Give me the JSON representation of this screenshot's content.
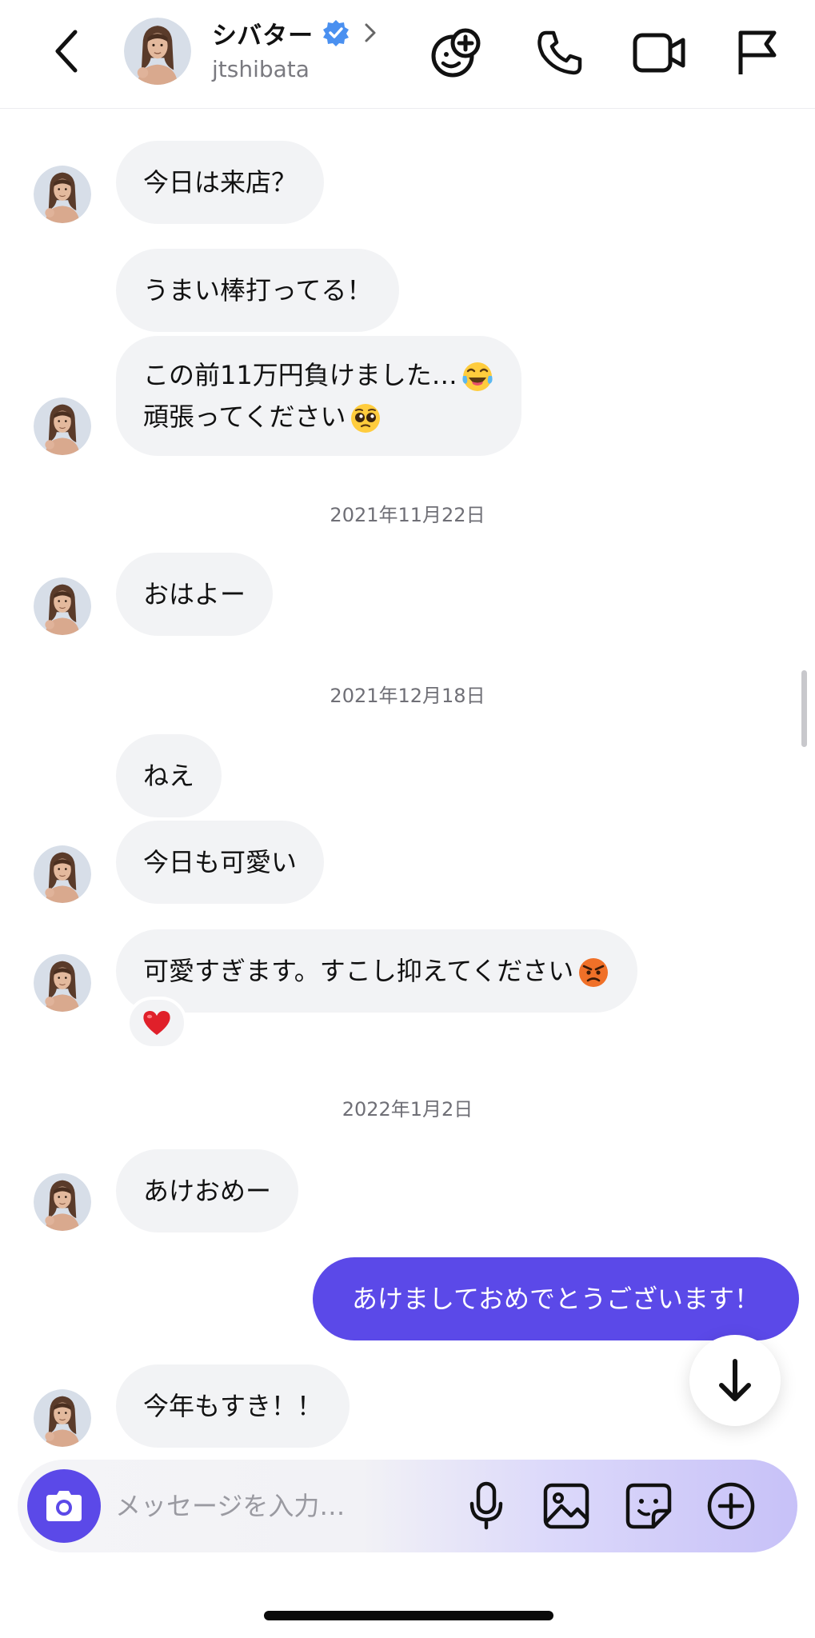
{
  "header": {
    "name": "シバター",
    "username": "jtshibata"
  },
  "messages": [
    {
      "text": "今日は来店？",
      "direction": "incoming"
    },
    {
      "text": "うまい棒打ってる！",
      "direction": "incoming"
    },
    {
      "line1": "この前11万円負けました…",
      "line1_emoji": "face-with-tears-of-joy",
      "line2": "頑張ってください",
      "line2_emoji": "pleading-face",
      "direction": "incoming"
    },
    {
      "text": "おはよー",
      "direction": "incoming"
    },
    {
      "text": "ねえ",
      "direction": "incoming"
    },
    {
      "text": "今日も可愛い",
      "direction": "incoming"
    },
    {
      "text": "可愛すぎます。すこし抑えてください",
      "emoji": "angry-face",
      "reaction": "red-heart",
      "direction": "incoming"
    },
    {
      "text": "あけおめー",
      "direction": "incoming"
    },
    {
      "text": "あけましておめでとうございます！",
      "direction": "outgoing"
    },
    {
      "text": "今年もすき！！",
      "direction": "incoming"
    }
  ],
  "date_separators": [
    "2021年11月22日",
    "2021年12月18日",
    "2022年1月2日"
  ],
  "input": {
    "placeholder": "メッセージを入力…"
  },
  "colors": {
    "accent": "#5b49e8",
    "incoming_bubble": "#f2f3f5",
    "verified": "#4a90f0"
  }
}
